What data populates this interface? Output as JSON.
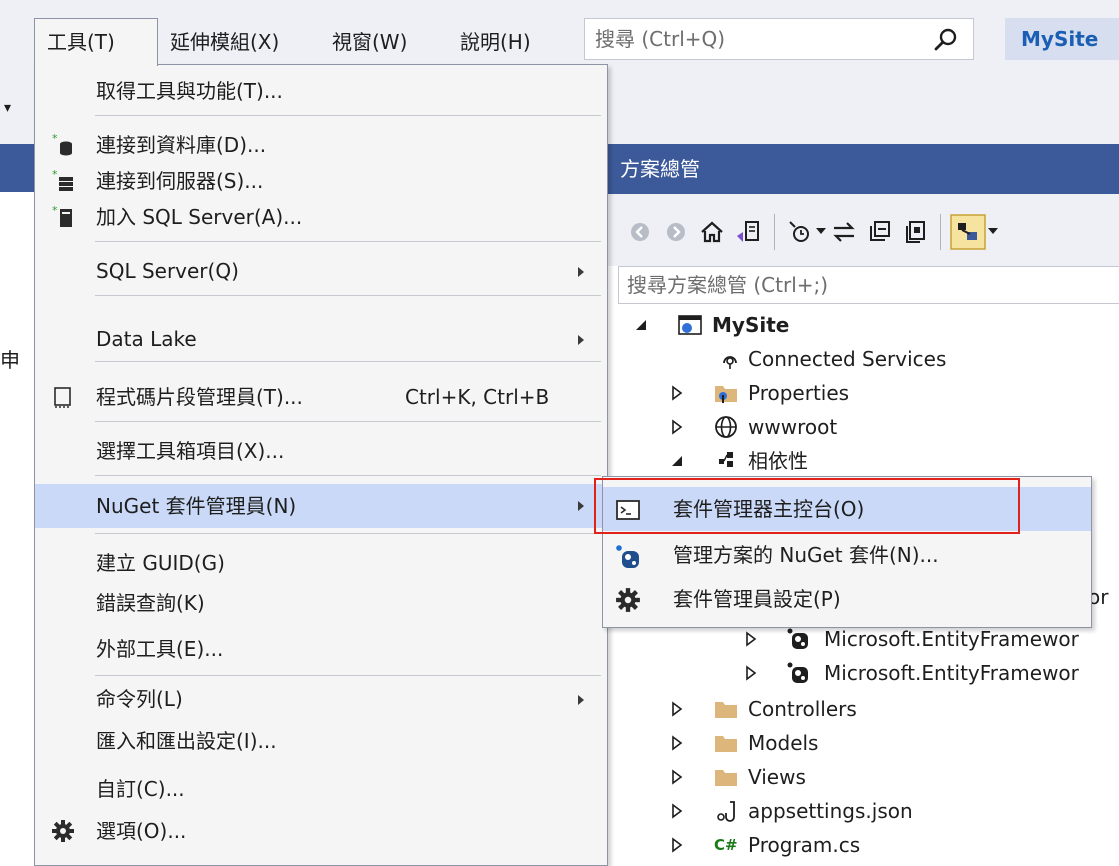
{
  "menubar": {
    "items": [
      "工具(T)",
      "延伸模組(X)",
      "視窗(W)",
      "說明(H)"
    ],
    "search_placeholder": "搜尋 (Ctrl+Q)",
    "project_name": "MySite"
  },
  "tools_menu": {
    "items": [
      {
        "label": "取得工具與功能(T)...",
        "icon": ""
      },
      {
        "label": "連接到資料庫(D)...",
        "icon": "database-connect-icon"
      },
      {
        "label": "連接到伺服器(S)...",
        "icon": "server-connect-icon"
      },
      {
        "label": "加入 SQL Server(A)...",
        "icon": "add-sql-server-icon"
      },
      {
        "label": "SQL Server(Q)",
        "submenu": true
      },
      {
        "label": "Data Lake",
        "submenu": true
      },
      {
        "label": "程式碼片段管理員(T)...",
        "shortcut": "Ctrl+K, Ctrl+B",
        "icon": "snippet-icon"
      },
      {
        "label": "選擇工具箱項目(X)..."
      },
      {
        "label": "NuGet 套件管理員(N)",
        "submenu": true,
        "highlighted": true
      },
      {
        "label": "建立 GUID(G)"
      },
      {
        "label": "錯誤查詢(K)"
      },
      {
        "label": "外部工具(E)..."
      },
      {
        "label": "命令列(L)",
        "submenu": true
      },
      {
        "label": "匯入和匯出設定(I)..."
      },
      {
        "label": "自訂(C)..."
      },
      {
        "label": "選項(O)...",
        "icon": "gear-icon"
      }
    ]
  },
  "nuget_submenu": {
    "items": [
      {
        "label": "套件管理器主控台(O)",
        "icon": "console-icon",
        "highlighted": true
      },
      {
        "label": "管理方案的 NuGet 套件(N)...",
        "icon": "nuget-icon"
      },
      {
        "label": "套件管理員設定(P)",
        "icon": "gear-icon"
      }
    ]
  },
  "solution_explorer": {
    "title": "方案總管",
    "search_placeholder": "搜尋方案總管 (Ctrl+;)",
    "tree": [
      {
        "label": "MySite",
        "bold": true,
        "expanded": true
      },
      {
        "label": "Connected Services"
      },
      {
        "label": "Properties"
      },
      {
        "label": "wwwroot"
      },
      {
        "label": "相依性",
        "expanded": true
      },
      {
        "label": "Microsoft.EntityFramewor"
      },
      {
        "label": "Microsoft.EntityFramewor"
      },
      {
        "label": "Controllers"
      },
      {
        "label": "Models"
      },
      {
        "label": "Views"
      },
      {
        "label": "appsettings.json"
      },
      {
        "label": "Program.cs"
      }
    ],
    "partial_char": "or"
  },
  "background": {
    "side_char": "申"
  },
  "colors": {
    "title_bar": "#3c5a99",
    "menu_bg": "#f5f5f5",
    "menu_highlight": "#c9d9f7",
    "callout_border": "#e0221b",
    "folder": "#dcb67a",
    "project_blue": "#1a5fb4"
  }
}
